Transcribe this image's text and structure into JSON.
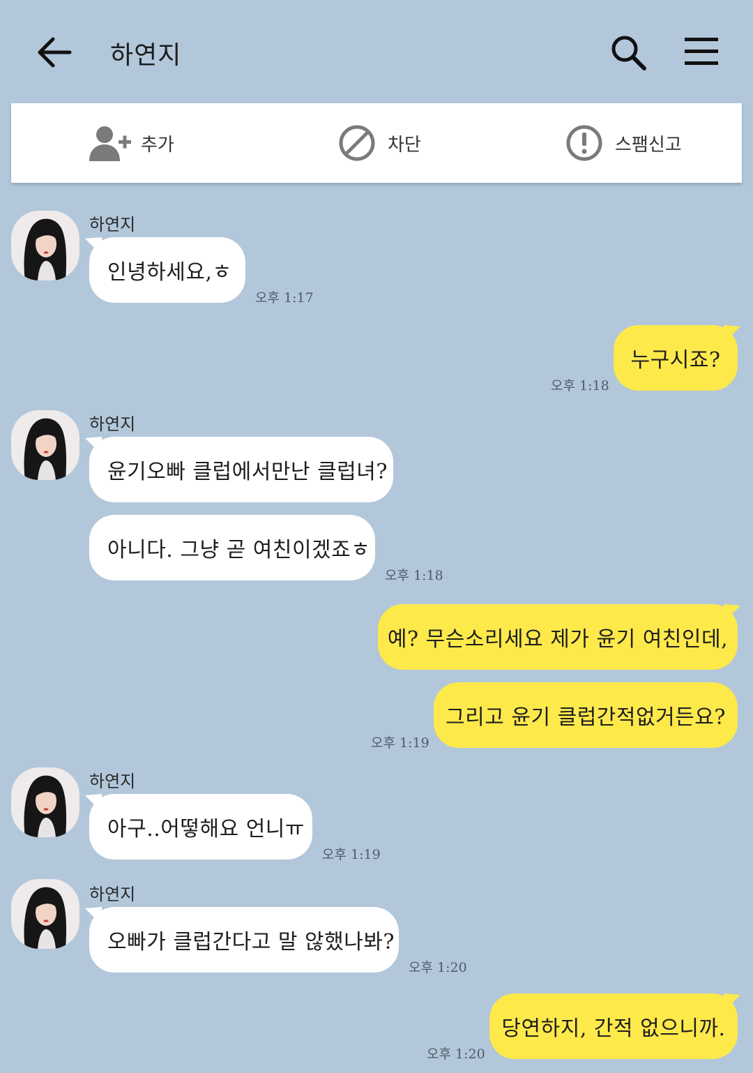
{
  "header": {
    "title": "하연지",
    "back_icon": "arrow-left-icon",
    "search_icon": "search-icon",
    "menu_icon": "hamburger-menu-icon"
  },
  "action_bar": {
    "add_label": "추가",
    "block_label": "차단",
    "spam_label": "스팸신고"
  },
  "colors": {
    "background": "#b2c7da",
    "incoming_bubble": "#ffffff",
    "outgoing_bubble": "#fee94b"
  },
  "messages": [
    {
      "from": "하연지",
      "text": "인녕하세요,ㅎ",
      "time": "오후 1:17"
    },
    {
      "from": "me",
      "text": "누구시죠?",
      "time": "오후 1:18"
    },
    {
      "from": "하연지",
      "text": "윤기오빠 클럽에서만난 클럽녀?"
    },
    {
      "from": "하연지",
      "text": "아니다. 그냥 곧 여친이겠죠ㅎ",
      "time": "오후 1:18"
    },
    {
      "from": "me",
      "text": "예? 무슨소리세요 제가 윤기 여친인데,"
    },
    {
      "from": "me",
      "text": "그리고 윤기 클럽간적없거든요?",
      "time": "오후 1:19"
    },
    {
      "from": "하연지",
      "text": "아구..어떻해요 언니ㅠ",
      "time": "오후 1:19"
    },
    {
      "from": "하연지",
      "text": "오빠가 클럽간다고 말 않했나봐?",
      "time": "오후 1:20"
    },
    {
      "from": "me",
      "text": "당연하지, 간적 없으니까.",
      "time": "오후 1:20"
    }
  ]
}
